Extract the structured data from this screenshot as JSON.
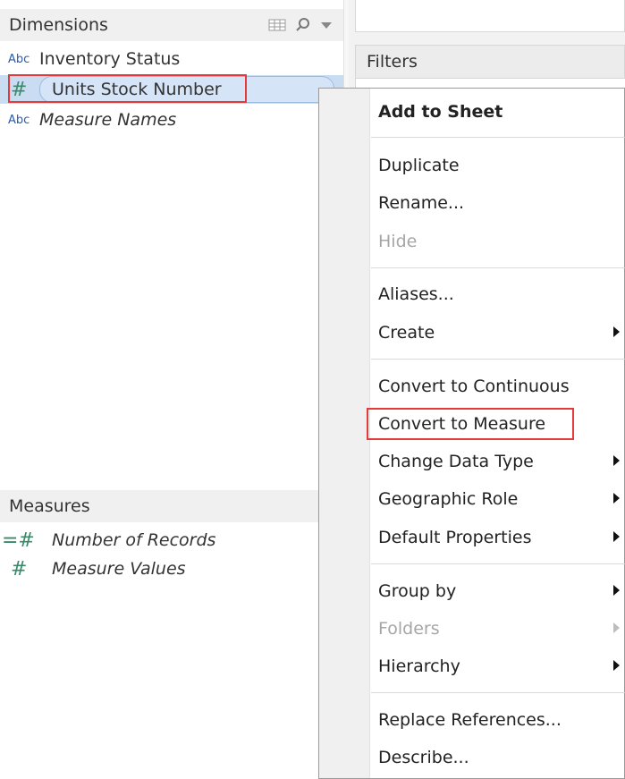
{
  "dimensions": {
    "title": "Dimensions",
    "fields": [
      {
        "type_icon": "Abc",
        "label": "Inventory Status"
      },
      {
        "type_icon": "#",
        "label": "Units Stock Number"
      },
      {
        "type_icon": "Abc",
        "label": "Measure Names"
      }
    ]
  },
  "measures": {
    "title": "Measures",
    "fields": [
      {
        "type_icon": "=#",
        "label": "Number of Records"
      },
      {
        "type_icon": "#",
        "label": "Measure Values"
      }
    ]
  },
  "shelves": {
    "filters_title": "Filters"
  },
  "context_menu": {
    "items": [
      {
        "label": "Add to Sheet"
      },
      {
        "label": "Duplicate"
      },
      {
        "label": "Rename..."
      },
      {
        "label": "Hide"
      },
      {
        "label": "Aliases..."
      },
      {
        "label": "Create"
      },
      {
        "label": "Convert to Continuous"
      },
      {
        "label": "Convert to Measure"
      },
      {
        "label": "Change Data Type"
      },
      {
        "label": "Geographic Role"
      },
      {
        "label": "Default Properties"
      },
      {
        "label": "Group by"
      },
      {
        "label": "Folders"
      },
      {
        "label": "Hierarchy"
      },
      {
        "label": "Replace References..."
      },
      {
        "label": "Describe..."
      }
    ]
  },
  "colors": {
    "selection": "#c9dcf2",
    "highlight_box": "#e43a3a",
    "dimension_icon": "#2a5ca8",
    "measure_icon": "#3a8a6a"
  }
}
